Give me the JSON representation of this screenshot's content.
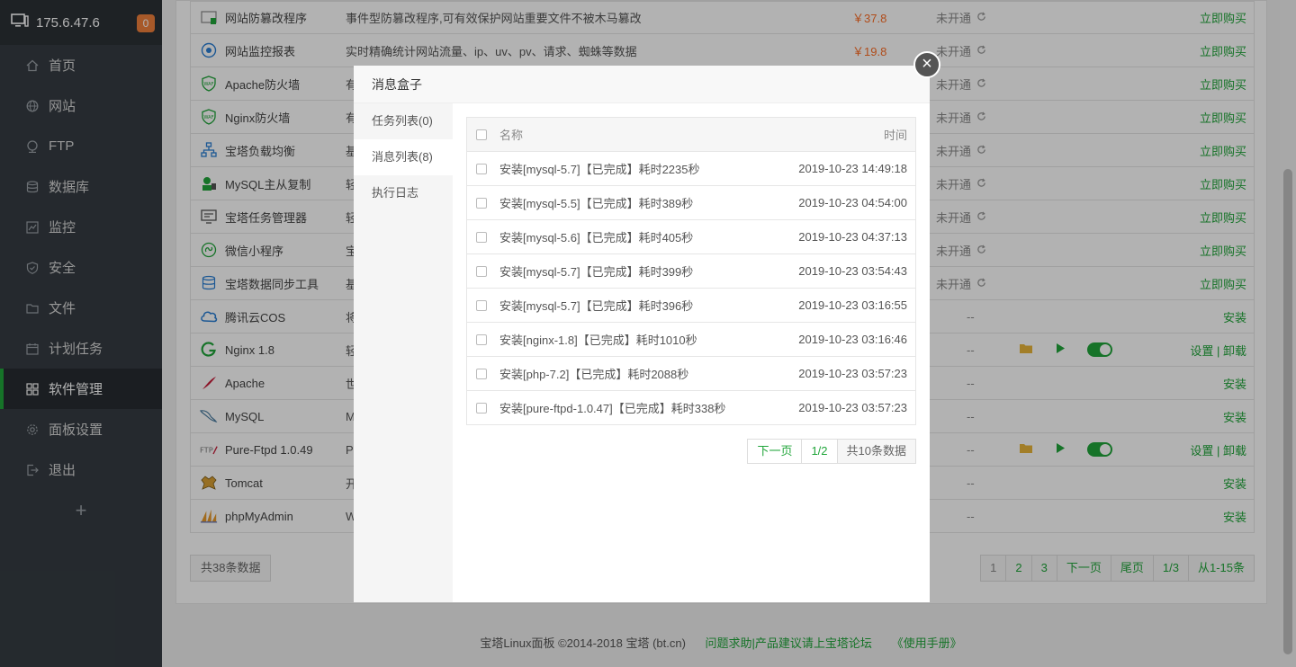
{
  "sidebar": {
    "ip": "175.6.47.6",
    "badge": "0",
    "items": [
      {
        "label": "首页",
        "icon": "home-icon"
      },
      {
        "label": "网站",
        "icon": "globe-icon"
      },
      {
        "label": "FTP",
        "icon": "ftp-icon"
      },
      {
        "label": "数据库",
        "icon": "database-icon"
      },
      {
        "label": "监控",
        "icon": "monitor-icon"
      },
      {
        "label": "安全",
        "icon": "shield-icon"
      },
      {
        "label": "文件",
        "icon": "folder-icon"
      },
      {
        "label": "计划任务",
        "icon": "calendar-icon"
      },
      {
        "label": "软件管理",
        "icon": "grid-icon"
      },
      {
        "label": "面板设置",
        "icon": "gear-icon"
      },
      {
        "label": "退出",
        "icon": "logout-icon"
      }
    ],
    "add": "+"
  },
  "software": {
    "rows": [
      {
        "name": "网站防篡改程序",
        "desc": "事件型防篡改程序,可有效保护网站重要文件不被木马篡改",
        "price": "￥37.8",
        "status": "未开通",
        "action": "立即购买"
      },
      {
        "name": "网站监控报表",
        "desc": "实时精确统计网站流量、ip、uv、pv、请求、蜘蛛等数据",
        "price": "￥19.8",
        "status": "未开通",
        "action": "立即购买"
      },
      {
        "name": "Apache防火墙",
        "desc": "有",
        "price": "",
        "status": "未开通",
        "action": "立即购买"
      },
      {
        "name": "Nginx防火墙",
        "desc": "有",
        "price": "",
        "status": "未开通",
        "action": "立即购买"
      },
      {
        "name": "宝塔负载均衡",
        "desc": "基",
        "price": "",
        "status": "未开通",
        "action": "立即购买"
      },
      {
        "name": "MySQL主从复制",
        "desc": "轻",
        "price": "",
        "status": "未开通",
        "action": "立即购买"
      },
      {
        "name": "宝塔任务管理器",
        "desc": "轻",
        "price": "",
        "status": "未开通",
        "action": "立即购买"
      },
      {
        "name": "微信小程序",
        "desc": "宝",
        "price": "",
        "status": "未开通",
        "action": "立即购买"
      },
      {
        "name": "宝塔数据同步工具",
        "desc": "基",
        "price": "",
        "status": "未开通",
        "action": "立即购买"
      },
      {
        "name": "腾讯云COS",
        "desc": "将",
        "price": "",
        "status": "--",
        "action": "安装"
      },
      {
        "name": "Nginx 1.8",
        "desc": "轻",
        "price": "",
        "status": "--",
        "action": "设置 | 卸载",
        "installed": true
      },
      {
        "name": "Apache",
        "desc": "世",
        "price": "",
        "status": "--",
        "action": "安装"
      },
      {
        "name": "MySQL",
        "desc": "M",
        "price": "",
        "status": "--",
        "action": "安装"
      },
      {
        "name": "Pure-Ftpd 1.0.49",
        "desc": "Pu",
        "price": "",
        "status": "--",
        "action": "设置 | 卸载",
        "installed": true
      },
      {
        "name": "Tomcat",
        "desc": "开",
        "price": "",
        "status": "--",
        "action": "安装"
      },
      {
        "name": "phpMyAdmin",
        "desc": "W",
        "price": "",
        "status": "--",
        "action": "安装"
      }
    ],
    "total": "共38条数据",
    "pager": [
      "1",
      "2",
      "3",
      "下一页",
      "尾页",
      "1/3",
      "从1-15条"
    ]
  },
  "footer": {
    "copyright": "宝塔Linux面板 ©2014-2018 宝塔 (bt.cn)",
    "forum": "问题求助|产品建议请上宝塔论坛",
    "manual": "《使用手册》"
  },
  "modal": {
    "title": "消息盒子",
    "close": "×",
    "tabs": [
      "任务列表(0)",
      "消息列表(8)",
      "执行日志"
    ],
    "header": {
      "name": "名称",
      "time": "时间"
    },
    "messages": [
      {
        "name": "安装[mysql-5.7]【已完成】耗时2235秒",
        "time": "2019-10-23 14:49:18"
      },
      {
        "name": "安装[mysql-5.5]【已完成】耗时389秒",
        "time": "2019-10-23 04:54:00"
      },
      {
        "name": "安装[mysql-5.6]【已完成】耗时405秒",
        "time": "2019-10-23 04:37:13"
      },
      {
        "name": "安装[mysql-5.7]【已完成】耗时399秒",
        "time": "2019-10-23 03:54:43"
      },
      {
        "name": "安装[mysql-5.7]【已完成】耗时396秒",
        "time": "2019-10-23 03:16:55"
      },
      {
        "name": "安装[nginx-1.8]【已完成】耗时1010秒",
        "time": "2019-10-23 03:16:46"
      },
      {
        "name": "安装[php-7.2]【已完成】耗时2088秒",
        "time": "2019-10-23 03:57:23"
      },
      {
        "name": "安装[pure-ftpd-1.0.47]【已完成】耗时338秒",
        "time": "2019-10-23 03:57:23"
      }
    ],
    "pager": {
      "next": "下一页",
      "page": "1/2",
      "total": "共10条数据"
    }
  },
  "colors": {
    "accent": "#20a53a",
    "price": "#fc6d26",
    "sidebar": "#353c42"
  }
}
